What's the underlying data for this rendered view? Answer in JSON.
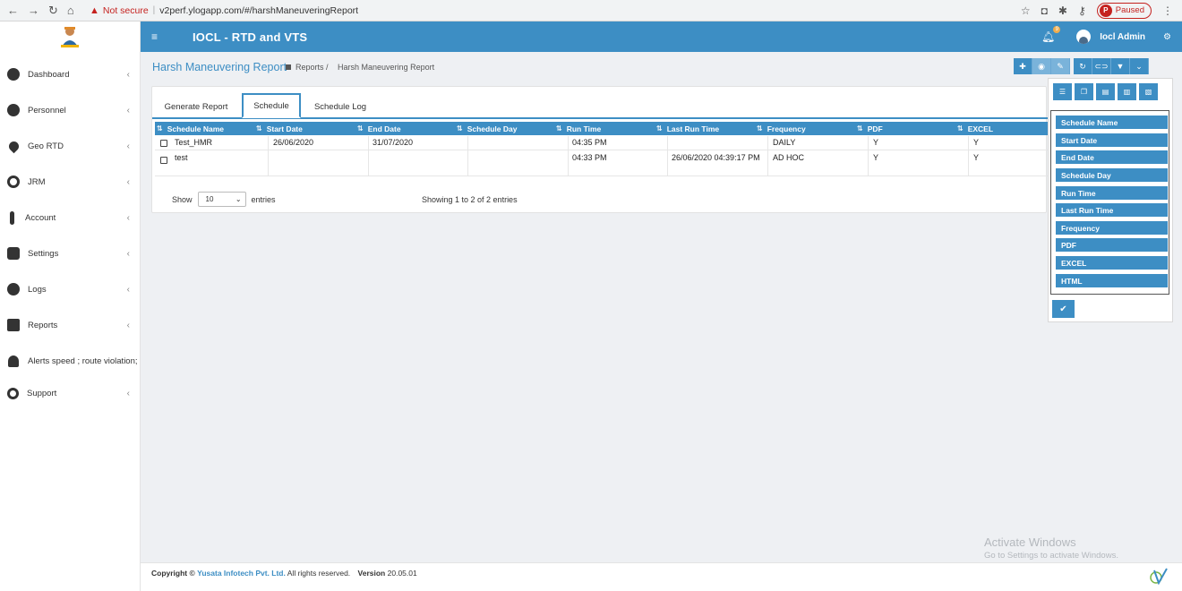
{
  "browser": {
    "not_secure": "Not secure",
    "url": "v2perf.ylogapp.com/#/harshManeuveringReport",
    "profile_initial": "P",
    "profile_status": "Paused"
  },
  "app": {
    "title": "IOCL - RTD and VTS",
    "notifications_count": "9",
    "user_name": "Iocl Admin"
  },
  "sidebar": {
    "items": [
      {
        "label": "Dashboard",
        "chev": "‹"
      },
      {
        "label": "Personnel",
        "chev": "‹"
      },
      {
        "label": "Geo RTD",
        "chev": "‹"
      },
      {
        "label": "JRM",
        "chev": "‹"
      },
      {
        "label": "Account",
        "chev": "‹"
      },
      {
        "label": "Settings",
        "chev": "‹"
      },
      {
        "label": "Logs",
        "chev": "‹"
      },
      {
        "label": "Reports",
        "chev": "‹"
      },
      {
        "label": "Alerts speed ; route violation;",
        "chev": ""
      },
      {
        "label": "Support",
        "chev": "‹"
      }
    ]
  },
  "page": {
    "title": "Harsh Maneuvering Report",
    "breadcrumb_parent": "Reports /",
    "breadcrumb_current": "Harsh Maneuvering Report"
  },
  "tabs": [
    {
      "label": "Generate Report"
    },
    {
      "label": "Schedule"
    },
    {
      "label": "Schedule Log"
    }
  ],
  "table": {
    "columns": [
      "Schedule Name",
      "Start Date",
      "End Date",
      "Schedule Day",
      "Run Time",
      "Last Run Time",
      "Frequency",
      "PDF",
      "EXCEL"
    ],
    "rows": [
      [
        "Test_HMR",
        "26/06/2020",
        "31/07/2020",
        "",
        "04:35 PM",
        "",
        "DAILY",
        "Y",
        "Y"
      ],
      [
        "test",
        "",
        "",
        "",
        "04:33 PM",
        "26/06/2020 04:39:17 PM",
        "AD HOC",
        "Y",
        "Y"
      ]
    ],
    "show_label": "Show",
    "entries_value": "10",
    "entries_label": "entries",
    "info": "Showing 1 to 2 of 2 entries"
  },
  "column_chooser": {
    "items": [
      "Schedule Name",
      "Start Date",
      "End Date",
      "Schedule Day",
      "Run Time",
      "Last Run Time",
      "Frequency",
      "PDF",
      "EXCEL",
      "HTML"
    ],
    "ok_icon": "check-icon"
  },
  "watermark": {
    "line1": "Activate Windows",
    "line2": "Go to Settings to activate Windows."
  },
  "footer": {
    "copyright_prefix": "Copyright ©",
    "company": "Yusata Infotech Pvt. Ltd.",
    "rights": "All rights reserved.",
    "version_label": "Version",
    "version": "20.05.01"
  },
  "colors": {
    "accent": "#3d8ec4",
    "warning": "#c5221f"
  }
}
